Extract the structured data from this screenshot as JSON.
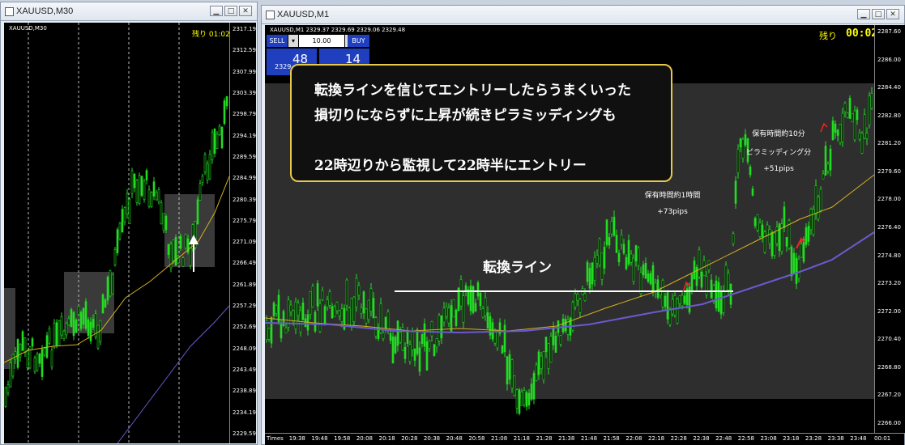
{
  "colors": {
    "candle_up": "#22dd22",
    "candle_down": "#22dd22",
    "ma_fast": "#d4b020",
    "ma_slow": "#6a5acd",
    "callout_border": "#e6c84a",
    "countdown": "#ffff00",
    "trade_panel": "#1f3fbf"
  },
  "left": {
    "title": "XAUUSD,M30",
    "chart_label": "XAUUSD,M30",
    "remaining": "残り 01:02",
    "y_labels": [
      "2317.19",
      "2312.59",
      "2307.99",
      "2303.39",
      "2298.79",
      "2294.19",
      "2289.59",
      "2284.99",
      "2280.39",
      "2275.79",
      "2271.09",
      "2266.49",
      "2261.89",
      "2257.29",
      "2252.69",
      "2248.09",
      "2243.49",
      "2238.89",
      "2234.19",
      "2229.59"
    ]
  },
  "right": {
    "title": "XAUUSD,M1",
    "chart_label": "XAUUSD,M1  2329.37 2329.69 2329.06 2329.48",
    "remaining_label": "残り",
    "remaining_time": "00:02",
    "trade": {
      "sell": "SELL",
      "buy": "BUY",
      "lot": "10.00",
      "sell_price_small": "2329",
      "sell_price_big": "48",
      "buy_price_big": "14"
    },
    "y_labels": [
      "2287.60",
      "2286.00",
      "2284.40",
      "2282.80",
      "2281.20",
      "2279.60",
      "2278.00",
      "2276.40",
      "2274.80",
      "2273.20",
      "2272.00",
      "2270.40",
      "2268.80",
      "2267.20",
      "2266.00"
    ],
    "x_labels": [
      "Times",
      "19:38",
      "19:48",
      "19:58",
      "20:08",
      "20:18",
      "20:28",
      "20:38",
      "20:48",
      "20:58",
      "21:08",
      "21:18",
      "21:28",
      "21:38",
      "21:48",
      "21:58",
      "22:08",
      "22:18",
      "22:28",
      "22:38",
      "22:48",
      "22:58",
      "23:08",
      "23:18",
      "23:28",
      "23:38",
      "23:48",
      "00:01"
    ],
    "callout": [
      "転換ラインを信じてエントリーしたらうまくいった",
      "損切りにならずに上昇が続きピラミッディングも",
      "",
      "22時辺りから監視して22時半にエントリー"
    ],
    "turn_line_label": "転換ライン",
    "note1": {
      "line1": "保有時間約1時間",
      "line2": "+73pips"
    },
    "note2": {
      "line1": "保有時間約10分",
      "line2": "ピラミッディング分",
      "line3": "+51pips"
    }
  }
}
